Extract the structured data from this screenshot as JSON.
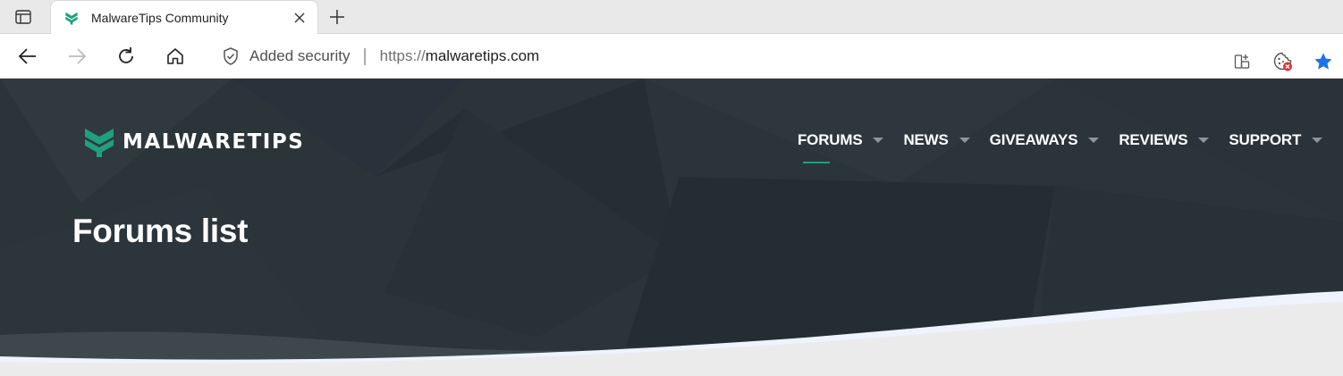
{
  "browser": {
    "tab": {
      "title": "MalwareTips Community",
      "favicon": "malwaretips-logo-icon"
    },
    "address_bar": {
      "security_label": "Added security",
      "separator": "|",
      "url_scheme": "https://",
      "url_host": "malwaretips.com"
    },
    "toolbar_icons": [
      "back-icon",
      "forward-icon",
      "refresh-icon",
      "home-icon",
      "split-screen-icon",
      "tracking-prevention-icon",
      "favorite-star-icon"
    ]
  },
  "site": {
    "logo_text": "MALWARETIPS",
    "nav": [
      {
        "label": "FORUMS",
        "active": true
      },
      {
        "label": "NEWS",
        "active": false
      },
      {
        "label": "GIVEAWAYS",
        "active": false
      },
      {
        "label": "REVIEWS",
        "active": false
      },
      {
        "label": "SUPPORT",
        "active": false
      }
    ],
    "page_title": "Forums list"
  },
  "colors": {
    "brand_green": "#1fa07e",
    "header_dark": "#2a3339",
    "page_bg": "#ebebeb",
    "star_blue": "#1a73e8"
  }
}
